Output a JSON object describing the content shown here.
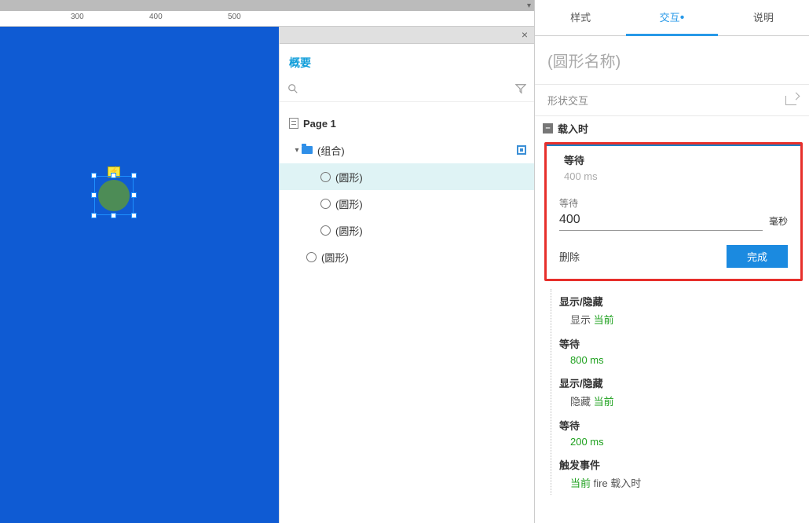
{
  "ruler": {
    "t300": "300",
    "t400": "400",
    "t500": "500"
  },
  "outline": {
    "title": "概要",
    "page": "Page 1",
    "group": "(组合)",
    "circle1": "(圆形)",
    "circle2": "(圆形)",
    "circle3": "(圆形)",
    "circle4": "(圆形)"
  },
  "right": {
    "tab_style": "样式",
    "tab_interact": "交互",
    "tab_notes": "说明",
    "name_placeholder": "(圆形名称)",
    "section_title": "形状交互",
    "event_name": "载入时"
  },
  "edit": {
    "title": "等待",
    "sub": "400 ms",
    "field_label": "等待",
    "value": "400",
    "unit": "毫秒",
    "delete": "删除",
    "done": "完成"
  },
  "actions": {
    "a1_t": "显示/隐藏",
    "a1_d": "显示 ",
    "a1_g": "当前",
    "a2_t": "等待",
    "a2_g": "800 ms",
    "a3_t": "显示/隐藏",
    "a3_d": "隐藏 ",
    "a3_g": "当前",
    "a4_t": "等待",
    "a4_g": "200 ms",
    "a5_t": "触发事件",
    "a5_g": "当前",
    "a5_d": " fire 载入时"
  }
}
